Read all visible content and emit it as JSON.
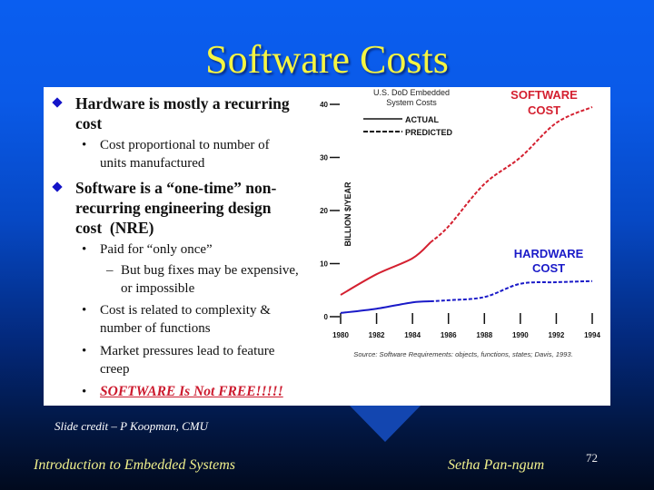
{
  "slide": {
    "title": "Software Costs",
    "credit": "Slide credit – P Koopman, CMU",
    "footer_left": "Introduction to Embedded Systems",
    "footer_right": "Setha Pan-ngum",
    "page_number": "72"
  },
  "bullets": [
    {
      "level": 1,
      "lines": [
        "Hardware is mostly a recurring",
        "cost"
      ],
      "children": [
        {
          "level": 2,
          "lines": [
            "Cost proportional to number of",
            "units manufactured"
          ]
        }
      ]
    },
    {
      "level": 1,
      "lines": [
        "Software is a “one-time” non-",
        "recurring engineering design",
        "cost  (NRE)"
      ],
      "children": [
        {
          "level": 2,
          "lines": [
            "Paid for “only once”"
          ],
          "children": [
            {
              "level": 3,
              "lines": [
                "But bug fixes may be expensive,",
                "or impossible"
              ]
            }
          ]
        },
        {
          "level": 2,
          "lines": [
            "Cost is related to complexity &",
            "number of functions"
          ]
        },
        {
          "level": 2,
          "lines": [
            "Market pressures lead to feature",
            "creep"
          ]
        },
        {
          "level": 2,
          "lines": [
            "SOFTWARE Is Not FREE!!!!!"
          ],
          "emphasis": true
        }
      ]
    }
  ],
  "colors": {
    "title": "#f5f542",
    "software_line": "#d42030",
    "hardware_line": "#1a1ac8",
    "bullet_diamond": "#1414c8",
    "emphasis": "#cc1a2e",
    "footer_text": "#f0f08c"
  },
  "chart_data": {
    "type": "line",
    "title": "U.S. DoD Embedded System Costs",
    "title_lines": [
      "U.S. DoD Embedded",
      "System Costs"
    ],
    "ylabel": "BILLION $/YEAR",
    "xlabel": "",
    "x": [
      1980,
      1982,
      1984,
      1986,
      1988,
      1990,
      1992,
      1994
    ],
    "xticks": [
      "1980",
      "1982",
      "1984",
      "1986",
      "1988",
      "1990",
      "1992",
      "1994"
    ],
    "yticks": [
      "0",
      "10",
      "20",
      "30",
      "40"
    ],
    "ylim": [
      0,
      40
    ],
    "xlim": [
      1980,
      1994
    ],
    "grid": false,
    "legend": {
      "placement": "top-left",
      "entries": [
        {
          "label": "ACTUAL",
          "style": "solid"
        },
        {
          "label": "PREDICTED",
          "style": "dashed"
        }
      ]
    },
    "series": [
      {
        "name": "SOFTWARE COST",
        "label_lines": [
          "SOFTWARE",
          "COST"
        ],
        "values": [
          4.1,
          8.0,
          11.0,
          17.0,
          25.0,
          30.0,
          36.5,
          39.5
        ],
        "actual_until": 1985
      },
      {
        "name": "HARDWARE COST",
        "label_lines": [
          "HARDWARE",
          "COST"
        ],
        "values": [
          0.7,
          1.5,
          2.7,
          3.1,
          3.7,
          6.2,
          6.5,
          6.7
        ],
        "actual_until": 1985
      }
    ],
    "source": "Source: Software Requirements: objects, functions, states; Davis, 1993."
  }
}
